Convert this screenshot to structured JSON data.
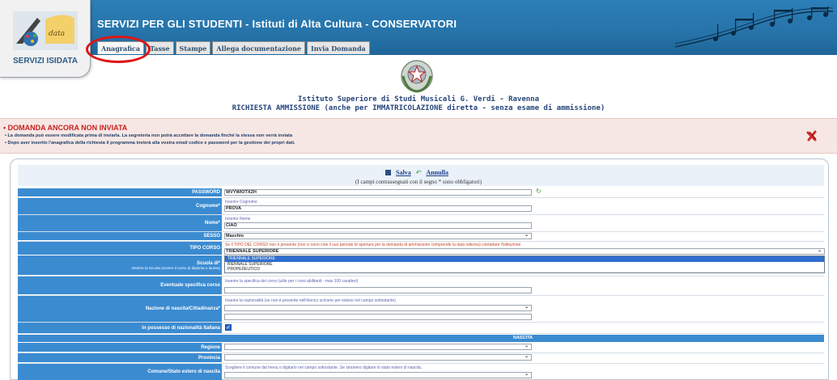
{
  "header": {
    "title": "SERVIZI PER GLI STUDENTI - Istituti di Alta Cultura - CONSERVATORI",
    "logo_label": "SERVIZI ISIDATA"
  },
  "tabs": [
    {
      "label": "Anagrafica"
    },
    {
      "label": "Tasse"
    },
    {
      "label": "Stampe"
    },
    {
      "label": "Allega documentazione"
    },
    {
      "label": "Invia Domanda"
    }
  ],
  "institute": {
    "title": "Istituto Superiore di Studi Musicali G. Verdi - Ravenna",
    "subtitle": "RICHIESTA AMMISSIONE (anche per IMMATRICOLAZIONE diretta - senza esame di ammissione)"
  },
  "notice": {
    "heading": "• DOMANDA ANCORA NON INVIATA",
    "line1": "• La domanda può essere modificata prima di inviarla. La segreteria non potrà accettare la domanda finché la stessa non verrà inviata",
    "line2": "• Dopo aver inserito l'anagrafica della richiesta il programma invierà alla vostra email codice e password per la gestione dei propri dati."
  },
  "actions": {
    "save": "Salva",
    "cancel": "Annulla",
    "required_note": "(I campi contrassegnati con il segno * sono obbligatori)"
  },
  "form": {
    "password_label": "PASSWORD",
    "password_value": "WVYWIOTXZH",
    "cognome_label": "Cognome*",
    "cognome_hint": "Inserire Cognome",
    "cognome_value": "PROVA",
    "nome_label": "Nome*",
    "nome_hint": "Inserire Nome",
    "nome_value": "CIAO",
    "sesso_label": "SESSO",
    "sesso_value": "Maschio",
    "tipo_corso_label": "TIPO CORSO",
    "tipo_corso_hint": "Se il TIPO DEL CORSO non è presente (non ci sono cioe il suo periodo di apertura per la domanda di ammissione comprende la data odierna) contattare l'Istituzione",
    "tipo_corso_value": "TRIENNALE SUPERIORE",
    "tipo_corso_options": [
      "TRIENNALE SUPERIORE",
      "BIENNALE SUPERIORE",
      "PROPEDEUTICO"
    ],
    "scuola_label": "Scuola di*",
    "scuola_sublabel": "Inserire la Scuola (ovvero il corso di diploma o laurea)",
    "specifica_label": "Eventuale specifica corso",
    "specifica_hint": "Inserire la specifica del corso (utile per i corsi abilitanti - max 100 caratteri)",
    "nazione_label": "Nazione di nascita/Cittadinanza*",
    "nazione_hint": "Inserire la nazionalità (se non è presente nell'elenco scrivere per esteso nel campo sottostante)",
    "italiana_label": "In possesso di nazionalità Italiana",
    "italiana_checked": true,
    "nascita_section": "NASCITA",
    "regione_label": "Regione",
    "provincia_label": "Provincia",
    "comune_label": "Comune/Stato estero di nascita",
    "comune_hint": "Scegliere il comune dal menu o digitarlo nel campo sottostante. Se straniero digitare lo stato estero di nascita."
  },
  "colors": {
    "header_blue": "#2673a9",
    "label_blue": "#3b8bd1",
    "annotation_red": "#e01515",
    "notice_red": "#c81e1e"
  },
  "icons": {
    "save": "floppy-disk-icon",
    "cancel": "undo-arrow-icon",
    "close": "close-x-icon",
    "refresh": "refresh-arrows-icon"
  }
}
